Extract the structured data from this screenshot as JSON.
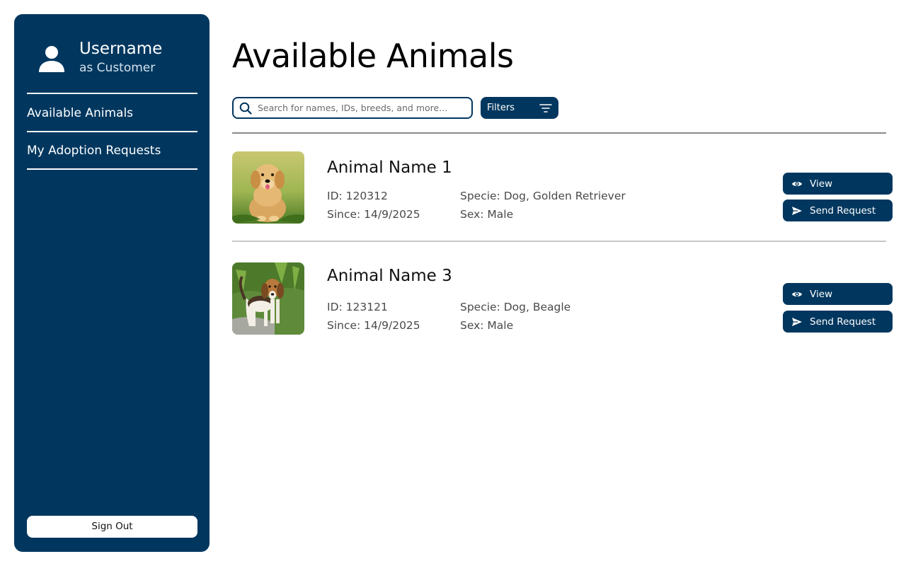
{
  "sidebar": {
    "username": "Username",
    "role": "as Customer",
    "nav": [
      {
        "label": "Available Animals"
      },
      {
        "label": "My Adoption Requests"
      }
    ],
    "sign_out": "Sign Out"
  },
  "main": {
    "title": "Available Animals",
    "search_placeholder": "Search for names, IDs, breeds, and more...",
    "filters_label": "Filters",
    "animals": [
      {
        "name": "Animal Name 1",
        "id": "ID: 120312",
        "since": "Since: 14/9/2025",
        "specie": "Specie: Dog, Golden Retriever",
        "sex": "Sex: Male",
        "view": "View",
        "send": "Send Request"
      },
      {
        "name": "Animal Name 3",
        "id": "ID: 123121",
        "since": "Since: 14/9/2025",
        "specie": "Specie: Dog, Beagle",
        "sex": "Sex: Male",
        "view": "View",
        "send": "Send Request"
      }
    ]
  },
  "colors": {
    "primary": "#01375f",
    "background": "#ffffff"
  },
  "icons": [
    "user-icon",
    "search-icon",
    "filter-icon",
    "eye-icon",
    "send-icon"
  ]
}
